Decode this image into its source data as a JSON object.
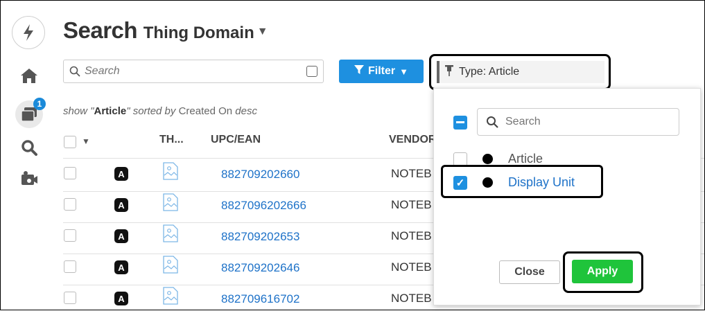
{
  "page": {
    "title": "Search",
    "domain": "Thing Domain",
    "search_placeholder": "Search",
    "filter_label": "Filter",
    "type_chip": "Type: Article",
    "sort_prefix": "show \"",
    "sort_type": "Article",
    "sort_mid": "\" sorted by ",
    "sort_field": "Created On",
    "sort_dir": " desc"
  },
  "rail": {
    "notification_count": "1"
  },
  "table": {
    "headers": {
      "thumb": "TH...",
      "upc": "UPC/EAN",
      "vendor": "VENDOR"
    },
    "rows": [
      {
        "badge": "A",
        "upc": "882709202660",
        "vendor": "NOTEB"
      },
      {
        "badge": "A",
        "upc": "8827096202666",
        "vendor": "NOTEB"
      },
      {
        "badge": "A",
        "upc": "882709202653",
        "vendor": "NOTEB"
      },
      {
        "badge": "A",
        "upc": "882709202646",
        "vendor": "NOTEB"
      },
      {
        "badge": "A",
        "upc": "882709616702",
        "vendor": "NOTEB"
      }
    ]
  },
  "dropdown": {
    "search_placeholder": "Search",
    "options": [
      {
        "label": "Article",
        "checked": false
      },
      {
        "label": "Display Unit",
        "checked": true
      }
    ],
    "close_label": "Close",
    "apply_label": "Apply"
  },
  "colors": {
    "accent": "#1e90e0",
    "link": "#1e72c8",
    "apply": "#1fc43b"
  }
}
